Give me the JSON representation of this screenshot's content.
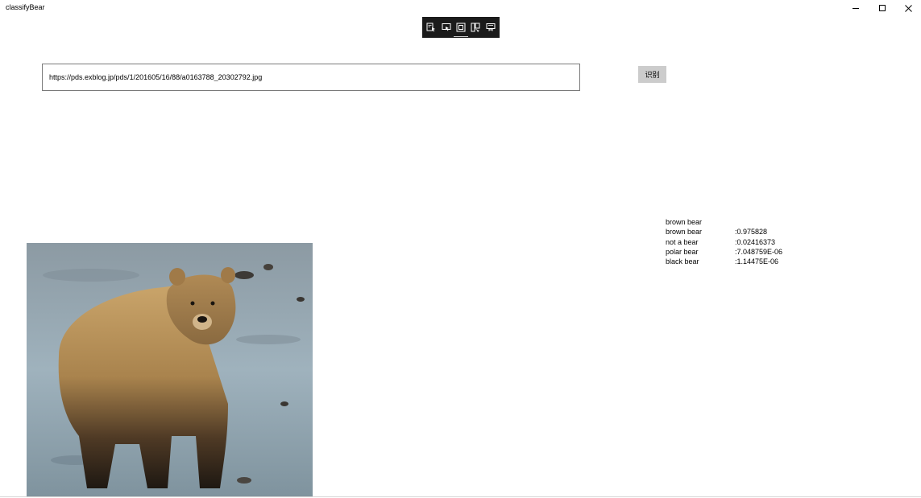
{
  "window": {
    "title": "classifyBear"
  },
  "debug_toolbar": {
    "icons": [
      "select-element-icon",
      "display-layout-adorners-icon",
      "track-focused-element-icon",
      "live-visual-tree-icon",
      "hot-reload-icon"
    ]
  },
  "url_input": {
    "value": "https://pds.exblog.jp/pds/1/201605/16/88/a0163788_20302792.jpg"
  },
  "recognize_button": {
    "label": "识别"
  },
  "results": {
    "top_label": "brown bear",
    "rows": [
      {
        "label": "brown bear",
        "score": ":0.975828"
      },
      {
        "label": "not a bear",
        "score": ":0.02416373"
      },
      {
        "label": "polar bear",
        "score": ":7.048759E-06"
      },
      {
        "label": "black bear",
        "score": ":1.14475E-06"
      }
    ]
  },
  "colors": {
    "toolbar_bg": "#1b1b1b",
    "button_bg": "#cccccc",
    "input_border": "#7a7a7a"
  }
}
